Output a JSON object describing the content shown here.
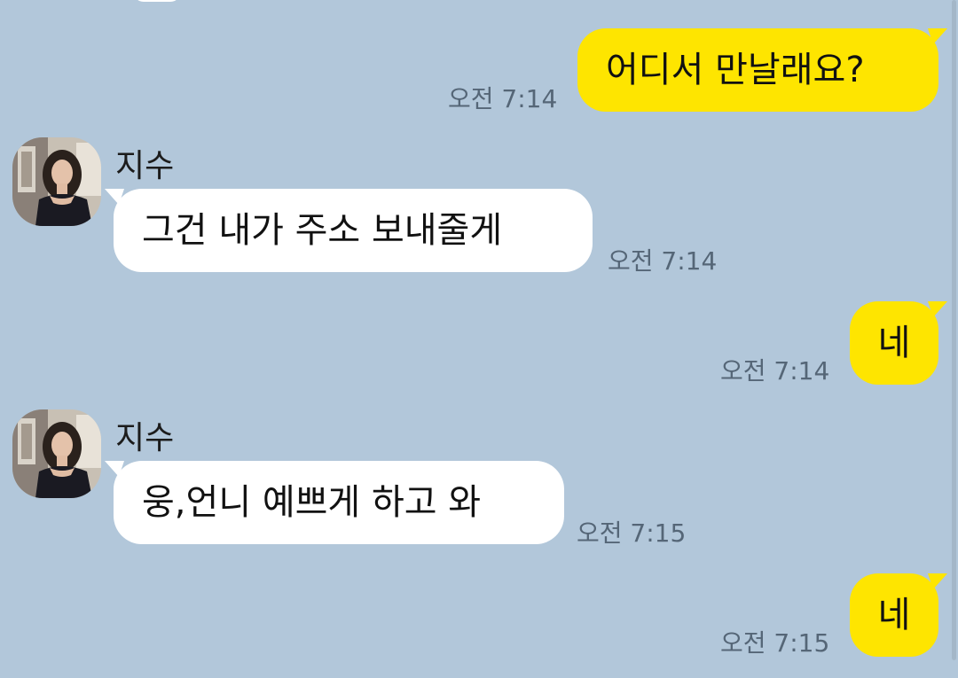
{
  "messages": [
    {
      "side": "out",
      "text": "어디서 만날래요?",
      "time": "오전 7:14"
    },
    {
      "side": "in",
      "sender": "지수",
      "text": "그건 내가 주소 보내줄게",
      "time": "오전 7:14"
    },
    {
      "side": "out",
      "text": "네",
      "time": "오전 7:14"
    },
    {
      "side": "in",
      "sender": "지수",
      "text": "웅,언니 예쁘게 하고 와",
      "time": "오전 7:15"
    },
    {
      "side": "out",
      "text": "네",
      "time": "오전 7:15"
    }
  ],
  "colors": {
    "background": "#b2c7da",
    "outgoing_bubble": "#fee500",
    "incoming_bubble": "#ffffff",
    "time_text": "#556677"
  },
  "icons": {
    "avatar": "profile-photo-icon"
  }
}
